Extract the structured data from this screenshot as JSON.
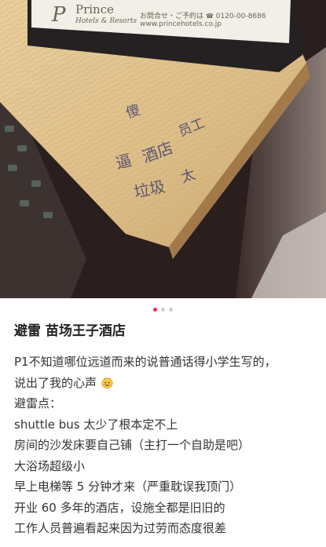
{
  "photo": {
    "card": {
      "brand": "Prince",
      "brand_sub": "Hotels & Resorts",
      "contact": "お問合せ・ご予約は",
      "phone": "0120-00-8686",
      "website": "www.princehotels.co.jp"
    },
    "handwriting": [
      "傻",
      "逼",
      "酒店",
      "垃圾",
      "员工",
      "太"
    ]
  },
  "carousel": {
    "count": 3,
    "active_index": 0
  },
  "post": {
    "title": "避雷 苗场王子酒店",
    "lines": [
      "P1不知道哪位远道而来的说普通话得小学生写的，",
      "说出了我的心声",
      "避雷点：",
      "shuttle bus 太少了根本定不上",
      "房间的沙发床要自己铺（主打一个自助是吧）",
      "大浴场超级小",
      "早上电梯等 5 分钟才来（严重耽误我顶门）",
      "开业 60 多年的酒店，设施全都是旧旧的",
      "工作人员普遍看起来因为过劳而态度很差"
    ],
    "emoji_icon": "smiling-face-icon"
  }
}
